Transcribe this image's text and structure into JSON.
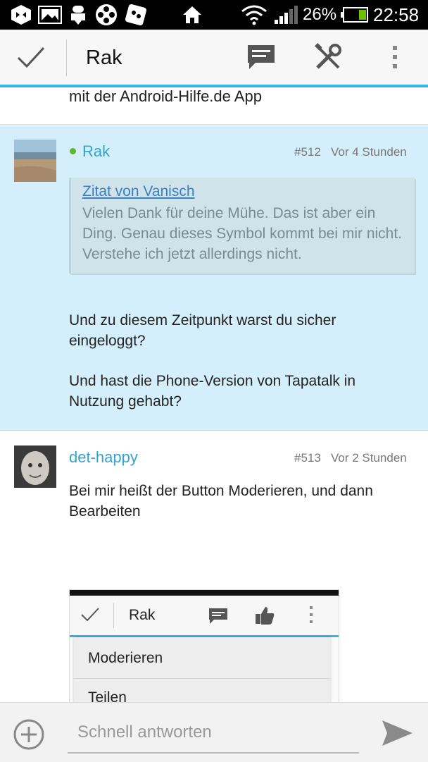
{
  "status_bar": {
    "battery_percent": "26%",
    "time": "22:58",
    "icons": [
      "notification-icon",
      "gallery-icon",
      "android-download-icon",
      "reel-icon",
      "media-icon",
      "home-icon",
      "wifi-icon",
      "signal-icon",
      "battery-icon"
    ]
  },
  "app_bar": {
    "title": "Rak",
    "icons": [
      "checkmark-icon",
      "message-icon",
      "tools-icon",
      "overflow-menu-icon"
    ],
    "accent_color": "#33b5e5"
  },
  "thread": {
    "previous_post_tail": "mit der Android-Hilfe.de App",
    "posts": [
      {
        "author": "Rak",
        "online": true,
        "number": "#512",
        "time": "Vor 4 Stunden",
        "quote": {
          "header": "Zitat von Vanisch",
          "text": "Vielen Dank für deine Mühe. Das ist aber ein Ding. Genau dieses Symbol kommt bei mir nicht. Verstehe ich jetzt allerdings nicht."
        },
        "paragraph_1": "Und zu diesem Zeitpunkt warst du sicher eingeloggt?",
        "paragraph_2": "Und hast die Phone-Version von Tapatalk in Nutzung gehabt?",
        "highlight_color": "#d4effb"
      },
      {
        "author": "det-happy",
        "number": "#513",
        "time": "Vor 2 Stunden",
        "text": "Bei mir heißt der Button Moderieren, und dann Bearbeiten",
        "embedded_screenshot": {
          "title": "Rak",
          "menu_items": [
            "Moderieren",
            "Teilen"
          ]
        }
      }
    ]
  },
  "reply_bar": {
    "placeholder": "Schnell antworten"
  }
}
